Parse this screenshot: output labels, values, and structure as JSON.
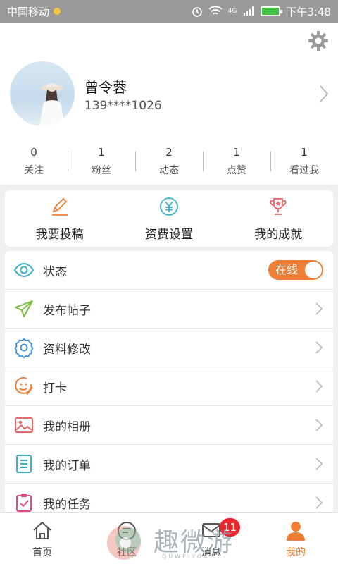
{
  "status_bar": {
    "carrier": "中国移动",
    "time": "下午3:48",
    "network": "4G"
  },
  "profile": {
    "name": "曾令蓉",
    "phone": "139****1026"
  },
  "stats": [
    {
      "count": "0",
      "label": "关注"
    },
    {
      "count": "1",
      "label": "粉丝"
    },
    {
      "count": "2",
      "label": "动态"
    },
    {
      "count": "1",
      "label": "点赞"
    },
    {
      "count": "1",
      "label": "看过我"
    }
  ],
  "quick_actions": [
    {
      "label": "我要投稿",
      "icon": "pen-icon",
      "color": "#f07f35"
    },
    {
      "label": "资费设置",
      "icon": "yen-icon",
      "color": "#3ab0c9"
    },
    {
      "label": "我的成就",
      "icon": "trophy-icon",
      "color": "#e46a6a"
    }
  ],
  "menu": {
    "status_label": "状态",
    "status_toggle": "在线",
    "items": [
      {
        "label": "发布帖子",
        "icon": "paper-plane-icon",
        "color": "#7cbd3b"
      },
      {
        "label": "资料修改",
        "icon": "settings-icon",
        "color": "#3a8fd6"
      },
      {
        "label": "打卡",
        "icon": "smile-pen-icon",
        "color": "#f07f35"
      },
      {
        "label": "我的相册",
        "icon": "album-icon",
        "color": "#e46a6a"
      },
      {
        "label": "我的订单",
        "icon": "order-list-icon",
        "color": "#3ab0c9"
      },
      {
        "label": "我的任务",
        "icon": "task-clipboard-icon",
        "color": "#e04c7a"
      }
    ]
  },
  "bottom_nav": [
    {
      "label": "首页",
      "icon": "home-icon"
    },
    {
      "label": "社区",
      "icon": "community-icon"
    },
    {
      "label": "消息",
      "icon": "message-icon",
      "badge": "11"
    },
    {
      "label": "我的",
      "icon": "profile-icon",
      "active": true
    }
  ],
  "watermark": {
    "text": "趣微游",
    "subtext": "QUWEIYOU"
  },
  "colors": {
    "accent": "#f07f35",
    "status_bar": "#9a9a9a",
    "badge": "#e8262c"
  }
}
